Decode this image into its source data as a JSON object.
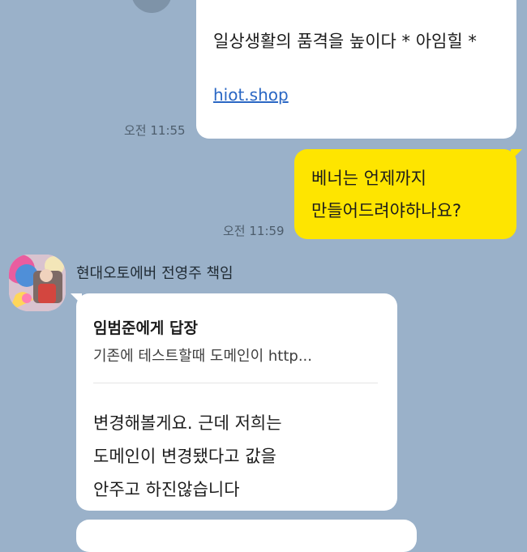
{
  "chat": {
    "link_card": {
      "title": "일상생활의 품격을 높이다 * 아임힐 *",
      "url_text": "hiot.shop",
      "time": "오전 11:55"
    },
    "my_message": {
      "line1": "베너는 언제까지",
      "line2": "만들어드려야하나요?",
      "time": "오전 11:59"
    },
    "reply": {
      "sender": "현대오토에버 전영주 책임",
      "reply_to": "임범준에게 답장",
      "quote": "기존에 테스트할때 도메인이    http...",
      "line1": "변경해볼게요. 근데 저희는",
      "line2": "도메인이 변경됐다고 값을",
      "line3": "안주고 하진않습니다"
    }
  },
  "icons": {
    "share": "share-icon",
    "avatar": "profile-photo"
  },
  "colors": {
    "background": "#9ab1c9",
    "my_bubble": "#fee500",
    "their_bubble": "#ffffff",
    "link": "#2a67c4"
  }
}
